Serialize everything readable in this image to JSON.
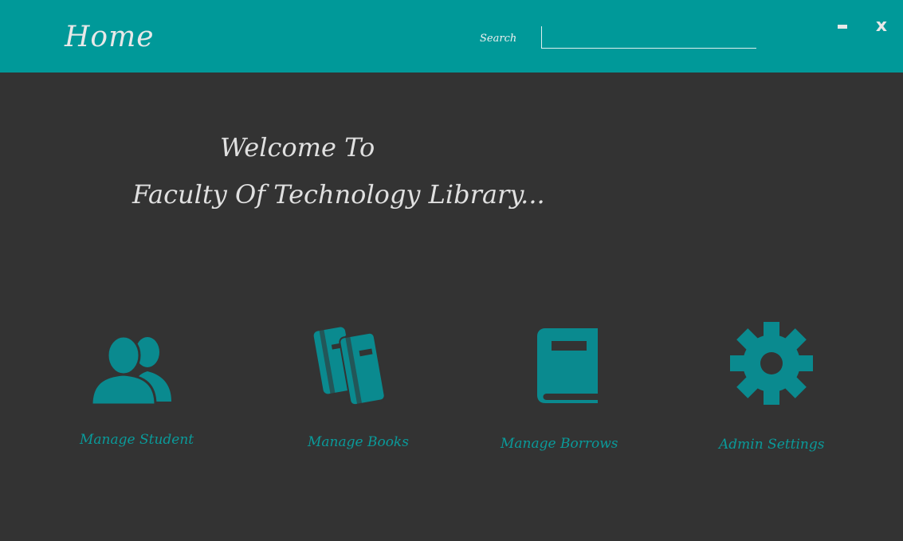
{
  "header": {
    "title": "Home",
    "search_label": "Search",
    "search_value": "",
    "minimize_icon": "minimize-icon",
    "close_label": "x"
  },
  "welcome": {
    "line1": "Welcome To",
    "line2": "Faculty Of Technology Library..."
  },
  "tiles": [
    {
      "label": "Manage Student",
      "icon": "users-icon"
    },
    {
      "label": "Manage Books",
      "icon": "books-icon"
    },
    {
      "label": "Manage Borrows",
      "icon": "book-icon"
    },
    {
      "label": "Admin Settings",
      "icon": "gear-icon"
    }
  ],
  "colors": {
    "header_bg": "#009999",
    "body_bg": "#333333",
    "accent": "#0a8a8f",
    "text_light": "#e0e0e0"
  }
}
